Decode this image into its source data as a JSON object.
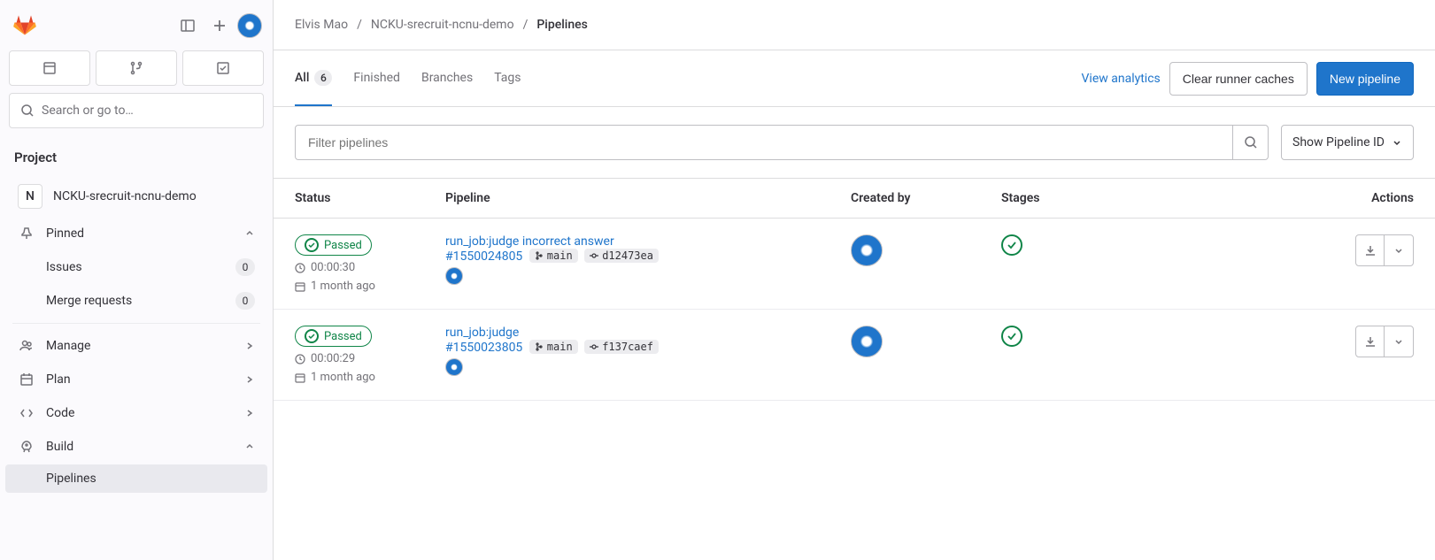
{
  "sidebar": {
    "search_placeholder": "Search or go to…",
    "project_label": "Project",
    "project_name": "NCKU-srecruit-ncnu-demo",
    "project_letter": "N",
    "pinned_label": "Pinned",
    "issues_label": "Issues",
    "issues_count": "0",
    "merge_label": "Merge requests",
    "merge_count": "0",
    "manage_label": "Manage",
    "plan_label": "Plan",
    "code_label": "Code",
    "build_label": "Build",
    "pipelines_label": "Pipelines"
  },
  "breadcrumb": {
    "owner": "Elvis Mao",
    "repo": "NCKU-srecruit-ncnu-demo",
    "current": "Pipelines"
  },
  "tabs": {
    "all": "All",
    "all_count": "6",
    "finished": "Finished",
    "branches": "Branches",
    "tags": "Tags"
  },
  "top_actions": {
    "view_analytics": "View analytics",
    "clear_caches": "Clear runner caches",
    "new_pipeline": "New pipeline"
  },
  "filter": {
    "placeholder": "Filter pipelines",
    "dropdown_label": "Show Pipeline ID"
  },
  "table": {
    "headers": {
      "status": "Status",
      "pipeline": "Pipeline",
      "created_by": "Created by",
      "stages": "Stages",
      "actions": "Actions"
    },
    "rows": [
      {
        "status": "Passed",
        "duration": "00:00:30",
        "age": "1 month ago",
        "title": "run_job:judge incorrect answer",
        "id": "#1550024805",
        "branch": "main",
        "commit": "d12473ea"
      },
      {
        "status": "Passed",
        "duration": "00:00:29",
        "age": "1 month ago",
        "title": "run_job:judge",
        "id": "#1550023805",
        "branch": "main",
        "commit": "f137caef"
      }
    ]
  }
}
